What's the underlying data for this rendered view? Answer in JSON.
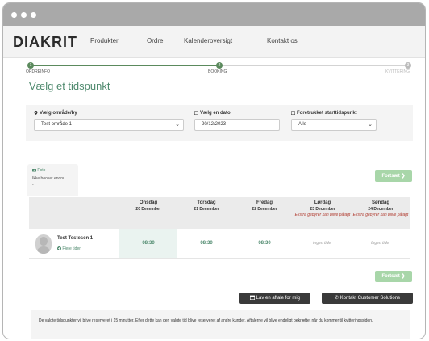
{
  "brand": "DIAKRIT",
  "nav": [
    "Produkter",
    "Ordre",
    "Kalenderoversigt",
    "Kontakt os"
  ],
  "steps": [
    {
      "num": "1",
      "label": "ORDREINFO"
    },
    {
      "num": "2",
      "label": "BOOKING"
    },
    {
      "num": "3",
      "label": "KVITTERING"
    }
  ],
  "page_title": "Vælg et tidspunkt",
  "filters": {
    "area_label": "Vælg område/by",
    "area_value": "Test område 1",
    "date_label": "Vælg en dato",
    "date_value": "20/12/2023",
    "time_label": "Foretrukket starttidspunkt",
    "time_value": "Alle"
  },
  "person_tab": {
    "photo_label": "Foto",
    "status_line1": "Ikke booket endnu",
    "status_line2": "-"
  },
  "continue_label": "Fortsæt",
  "days": [
    {
      "name": "Onsdag",
      "date": "20 December",
      "note": ""
    },
    {
      "name": "Torsdag",
      "date": "21 December",
      "note": ""
    },
    {
      "name": "Fredag",
      "date": "22 December",
      "note": ""
    },
    {
      "name": "Lørdag",
      "date": "23 December",
      "note": "Ekstra gebyrer kan blive pålagt"
    },
    {
      "name": "Søndag",
      "date": "24 December",
      "note": "Ekstra gebyrer kan blive pålagt"
    }
  ],
  "photographer": {
    "name": "Test Testesen 1",
    "more_times": "Flere tider",
    "slots": [
      "08:30",
      "08:30",
      "08:30",
      "Ingen tider",
      "Ingen tider"
    ]
  },
  "buttons": {
    "continue_bottom": "Fortsæt",
    "make_appointment": "Lav en aftale for mig",
    "contact": "Kontakt Customer Solutions"
  },
  "notice": "De valgte tidspunkter vil blive reserveret i 15 minutter. Efter dette kan den valgte tid blive reserveret af andre kunder. Aftalerne vil blive endeligt bekræftet når du kommer til kvitteringssiden.",
  "colors": {
    "accent": "#4f8a6e",
    "continue_button": "#a8d6a9",
    "dark_button": "#3a3a3a",
    "warning_text": "#b03a2e"
  },
  "icons": {
    "area": "map-pin-icon",
    "date": "calendar-icon",
    "time": "clock-icon",
    "photo": "camera-icon",
    "more_times": "plus-circle-icon",
    "continue": "chevron-right-icon",
    "appointment": "calendar-icon",
    "contact": "phone-icon"
  }
}
